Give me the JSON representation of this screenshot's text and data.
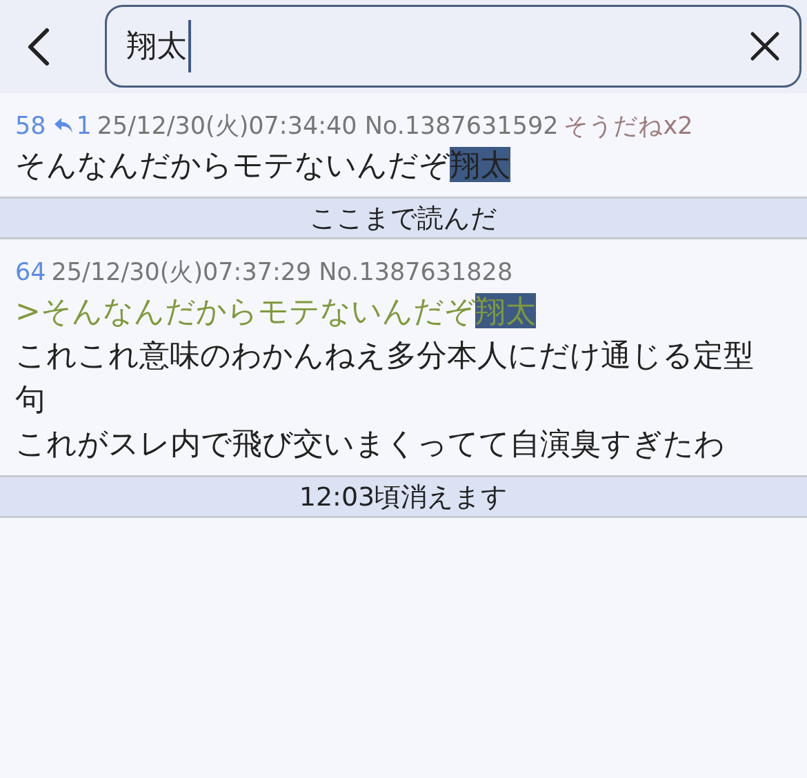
{
  "search": {
    "value": "翔太"
  },
  "rows": [
    {
      "kind": "post",
      "number": "58",
      "replies": "1",
      "datetime": "25/12/30(火)07:34:40 No.1387631592",
      "likes": "そうだねx2",
      "lines": [
        {
          "kind": "text",
          "segments": [
            {
              "text": "そんなんだからモテないんだぞ",
              "highlighted": false
            },
            {
              "text": "翔太",
              "highlighted": true
            }
          ]
        }
      ]
    },
    {
      "kind": "divider",
      "label": "ここまで読んだ"
    },
    {
      "kind": "post",
      "number": "64",
      "datetime": "25/12/30(火)07:37:29 No.1387631828",
      "lines": [
        {
          "kind": "quote",
          "segments": [
            {
              "text": ">そんなんだからモテないんだぞ",
              "highlighted": false
            },
            {
              "text": "翔太",
              "highlighted": true
            }
          ]
        },
        {
          "kind": "text",
          "segments": [
            {
              "text": "これこれ意味のわかんねえ多分本人にだけ通じる定型句",
              "highlighted": false
            }
          ]
        },
        {
          "kind": "text",
          "segments": [
            {
              "text": "これがスレ内で飛び交いまくってて自演臭すぎたわ",
              "highlighted": false
            }
          ]
        }
      ]
    },
    {
      "kind": "divider",
      "label": "12:03頃消えます"
    }
  ]
}
